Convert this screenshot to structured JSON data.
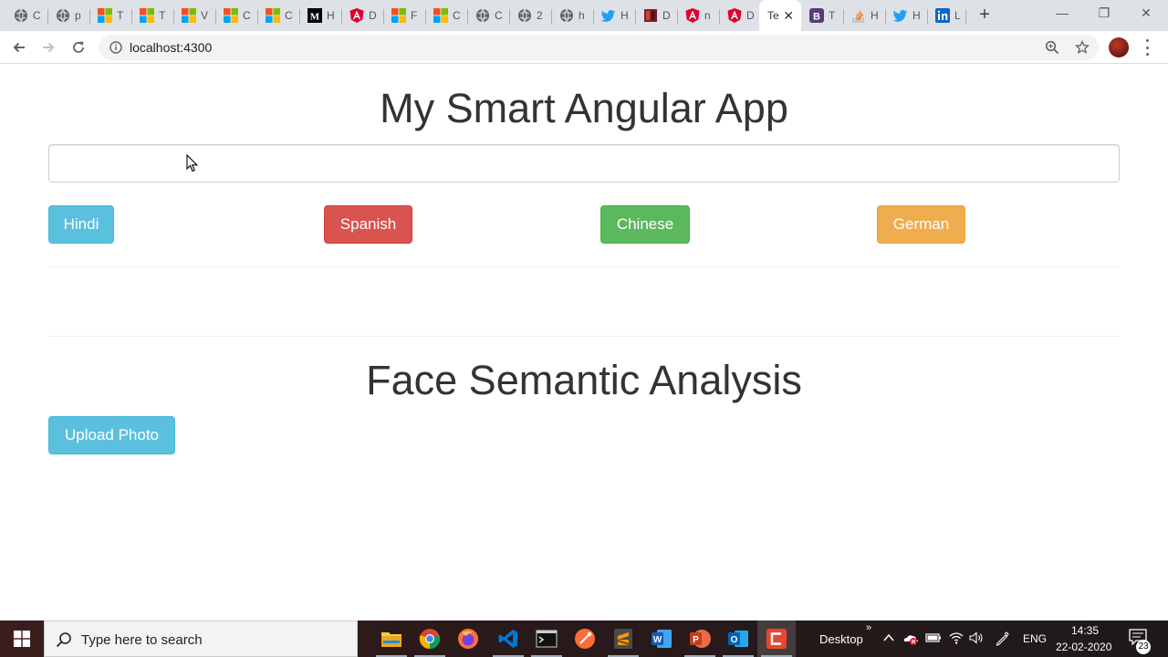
{
  "browser": {
    "tabs": [
      {
        "fav": "globe-icon",
        "label": "C"
      },
      {
        "fav": "globe-icon",
        "label": "p"
      },
      {
        "fav": "microsoft-icon",
        "label": "T"
      },
      {
        "fav": "microsoft-icon",
        "label": "T"
      },
      {
        "fav": "microsoft-icon",
        "label": "V"
      },
      {
        "fav": "microsoft-icon",
        "label": "C"
      },
      {
        "fav": "microsoft-icon",
        "label": "C"
      },
      {
        "fav": "medium-icon",
        "label": "H"
      },
      {
        "fav": "angular-icon",
        "label": "D"
      },
      {
        "fav": "microsoft-icon",
        "label": "F"
      },
      {
        "fav": "microsoft-icon",
        "label": "C"
      },
      {
        "fav": "globe-icon",
        "label": "C"
      },
      {
        "fav": "globe-icon",
        "label": "2"
      },
      {
        "fav": "globe-icon",
        "label": "h"
      },
      {
        "fav": "twitter-icon",
        "label": "H"
      },
      {
        "fav": "book-icon",
        "label": "D"
      },
      {
        "fav": "angular-icon",
        "label": "n"
      },
      {
        "fav": "angular-icon",
        "label": "D"
      },
      {
        "fav": "none",
        "label": "Te",
        "active": true
      },
      {
        "fav": "bootstrap-icon",
        "label": "T"
      },
      {
        "fav": "stackoverflow-icon",
        "label": "H"
      },
      {
        "fav": "twitter-icon",
        "label": "H"
      },
      {
        "fav": "linkedin-icon",
        "label": "L"
      }
    ],
    "active_tab_close": "✕",
    "new_tab": "+",
    "window_controls": {
      "minimize": "—",
      "restore": "❐",
      "close": "✕"
    },
    "url": "localhost:4300"
  },
  "page": {
    "title": "My Smart Angular App",
    "text_input": {
      "value": "",
      "placeholder": ""
    },
    "language_buttons": [
      {
        "label": "Hindi",
        "style": "info"
      },
      {
        "label": "Spanish",
        "style": "danger"
      },
      {
        "label": "Chinese",
        "style": "success"
      },
      {
        "label": "German",
        "style": "warning"
      }
    ],
    "section_title": "Face Semantic Analysis",
    "upload_button": "Upload Photo"
  },
  "colors": {
    "info": "#5bc0de",
    "danger": "#d9534f",
    "success": "#5cb85c",
    "warning": "#f0ad4e"
  },
  "taskbar": {
    "search_placeholder": "Type here to search",
    "apps": [
      "file-explorer-icon",
      "chrome-icon",
      "firefox-icon",
      "vscode-icon",
      "terminal-icon",
      "postman-icon",
      "sublime-icon",
      "word-icon",
      "powerpoint-icon",
      "outlook-icon",
      "camtasia-icon"
    ],
    "desktop_label": "Desktop",
    "language": "ENG",
    "time": "14:35",
    "date": "22-02-2020",
    "notifications": "23"
  }
}
